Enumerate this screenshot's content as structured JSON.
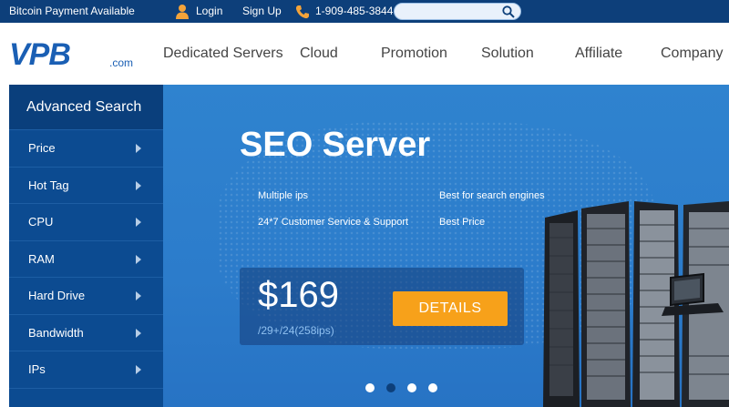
{
  "topbar": {
    "bitcoin": "Bitcoin Payment Available",
    "login": "Login",
    "signup": "Sign Up",
    "phone": "1-909-485-3844",
    "search_placeholder": ""
  },
  "header": {
    "logo_mark": "VPB",
    "logo_dotcom": ".com",
    "nav": [
      "Dedicated Servers",
      "Cloud",
      "Promotion",
      "Solution",
      "Affiliate",
      "Company"
    ]
  },
  "sidebar": {
    "title": "Advanced Search",
    "items": [
      "Price",
      "Hot Tag",
      "CPU",
      "RAM",
      "Hard Drive",
      "Bandwidth",
      "IPs"
    ]
  },
  "banner": {
    "headline": "SEO Server",
    "features": [
      "Multiple ips",
      "Best for search engines",
      "24*7 Customer Service & Support",
      "Best Price"
    ],
    "price": "$169",
    "price_sub": "/29+/24(258ips)",
    "details_label": "DETAILS",
    "slide_count": 4,
    "active_slide": 2
  },
  "colors": {
    "topbar": "#0d3f7a",
    "sidebar": "#0c4b91",
    "banner": "#2f83cf",
    "accent_button": "#f7a11a",
    "brand_blue": "#1a5fb4"
  },
  "icons": {
    "user": "user-icon",
    "phone": "phone-icon",
    "search": "search-icon",
    "arrow": "chevron-right-icon"
  }
}
